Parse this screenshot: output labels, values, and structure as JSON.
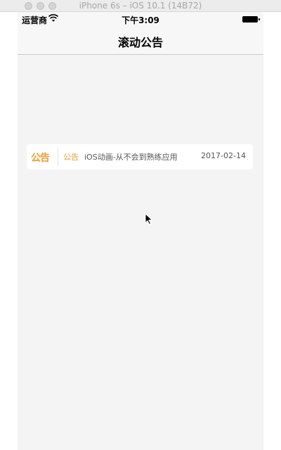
{
  "simulator": {
    "title": "iPhone 6s – iOS 10.1 (14B72)"
  },
  "status_bar": {
    "carrier": "运营商",
    "time": "下午3:09"
  },
  "nav": {
    "title": "滚动公告"
  },
  "notice": {
    "logo": "公告",
    "tag": "公告",
    "text": "iOS动画-从不会到熟练应用",
    "date": "2017-02-14",
    "accent_color": "#f29a2e"
  },
  "icons": {
    "wifi": "wifi-icon",
    "battery": "battery-icon",
    "cursor": "mouse-cursor-icon"
  }
}
